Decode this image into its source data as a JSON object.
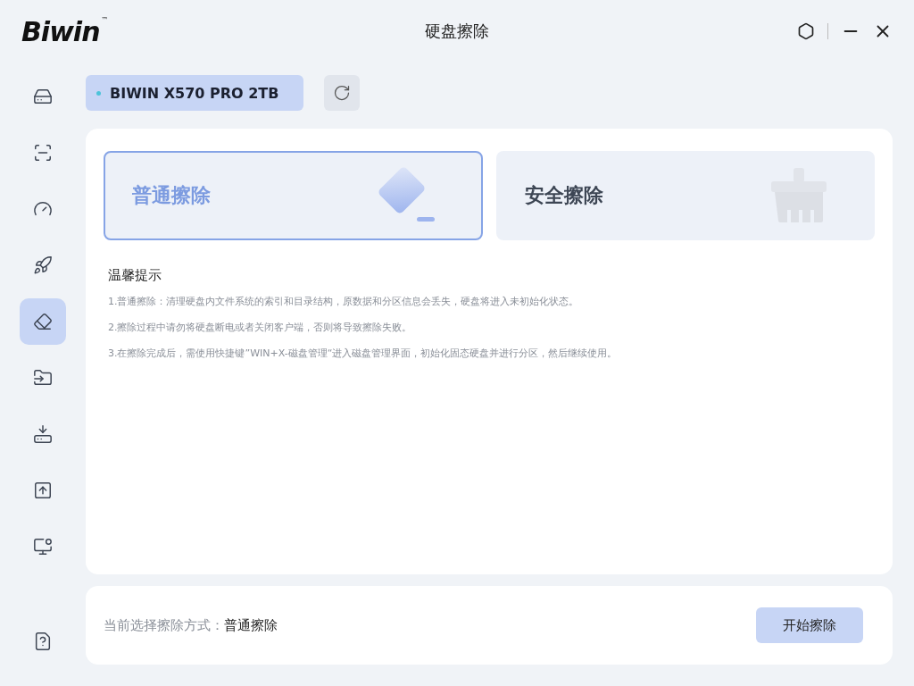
{
  "window": {
    "logo": "Biwin",
    "trademark": "™",
    "title": "硬盘擦除"
  },
  "sidebar": {
    "items": [
      {
        "selected": false
      },
      {
        "selected": false
      },
      {
        "selected": false
      },
      {
        "selected": false
      },
      {
        "selected": true
      },
      {
        "selected": false
      },
      {
        "selected": false
      },
      {
        "selected": false
      },
      {
        "selected": false
      }
    ],
    "help": {
      "selected": false
    }
  },
  "device": {
    "name": "BIWIN X570 PRO 2TB",
    "color": "#4cc3d9"
  },
  "modes": [
    {
      "label": "普通擦除",
      "selected": true
    },
    {
      "label": "安全擦除",
      "selected": false
    }
  ],
  "tips": {
    "title": "温馨提示",
    "lines": [
      "1.普通擦除：清理硬盘内文件系统的索引和目录结构，原数据和分区信息会丢失，硬盘将进入未初始化状态。",
      "2.擦除过程中请勿将硬盘断电或者关闭客户端，否则将导致擦除失败。",
      "3.在擦除完成后，需使用快捷键”WIN+X-磁盘管理“进入磁盘管理界面，初始化固态硬盘并进行分区，然后继续使用。"
    ]
  },
  "footer": {
    "label": "当前选择擦除方式：",
    "value": "普通擦除",
    "button": "开始擦除"
  }
}
